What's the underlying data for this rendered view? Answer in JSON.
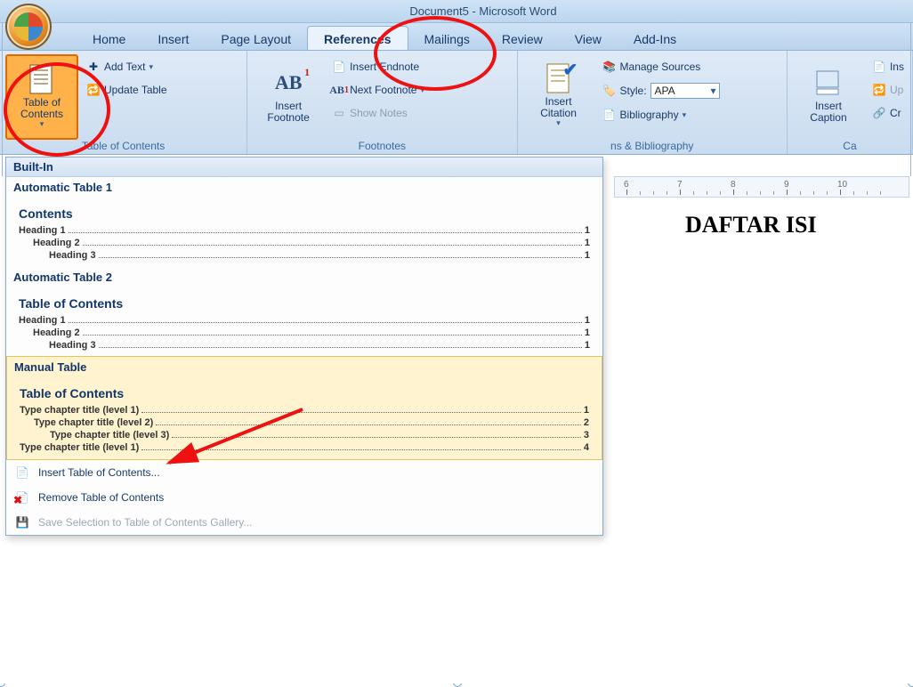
{
  "title": "Document5 - Microsoft Word",
  "tabs": {
    "home": "Home",
    "insert": "Insert",
    "page_layout": "Page Layout",
    "references": "References",
    "mailings": "Mailings",
    "review": "Review",
    "view": "View",
    "addins": "Add-Ins"
  },
  "ribbon": {
    "toc": {
      "label": "Table of\nContents",
      "add_text": "Add Text",
      "update": "Update Table",
      "group": "Table of Contents"
    },
    "footnotes": {
      "insert_footnote": "Insert\nFootnote",
      "insert_endnote": "Insert Endnote",
      "next_footnote": "Next Footnote",
      "show_notes": "Show Notes",
      "group": "Footnotes"
    },
    "citations": {
      "insert_citation": "Insert\nCitation",
      "manage": "Manage Sources",
      "style_label": "Style:",
      "style_value": "APA",
      "bibliography": "Bibliography",
      "group": "ns & Bibliography"
    },
    "captions": {
      "insert_caption": "Insert\nCaption",
      "ins": "Ins",
      "up": "Up",
      "cr": "Cr",
      "group": "Ca"
    }
  },
  "gallery": {
    "builtin": "Built-In",
    "auto1": {
      "title": "Automatic Table 1",
      "subtitle": "Contents",
      "rows": [
        {
          "label": "Heading 1",
          "page": "1",
          "indent": 0
        },
        {
          "label": "Heading 2",
          "page": "1",
          "indent": 1
        },
        {
          "label": "Heading 3",
          "page": "1",
          "indent": 2
        }
      ]
    },
    "auto2": {
      "title": "Automatic Table 2",
      "subtitle": "Table of Contents",
      "rows": [
        {
          "label": "Heading 1",
          "page": "1",
          "indent": 0
        },
        {
          "label": "Heading 2",
          "page": "1",
          "indent": 1
        },
        {
          "label": "Heading 3",
          "page": "1",
          "indent": 2
        }
      ]
    },
    "manual": {
      "title": "Manual Table",
      "subtitle": "Table of Contents",
      "rows": [
        {
          "label": "Type chapter title (level 1)",
          "page": "1",
          "indent": 0
        },
        {
          "label": "Type chapter title (level 2)",
          "page": "2",
          "indent": 1
        },
        {
          "label": "Type chapter title (level 3)",
          "page": "3",
          "indent": 2
        },
        {
          "label": "Type chapter title (level 1)",
          "page": "4",
          "indent": 0
        }
      ]
    },
    "footer": {
      "insert": "Insert Table of Contents...",
      "remove": "Remove Table of Contents",
      "save": "Save Selection to Table of Contents Gallery..."
    }
  },
  "document": {
    "heading": "DAFTAR ISI"
  },
  "ruler": {
    "start": 6,
    "end": 10
  }
}
